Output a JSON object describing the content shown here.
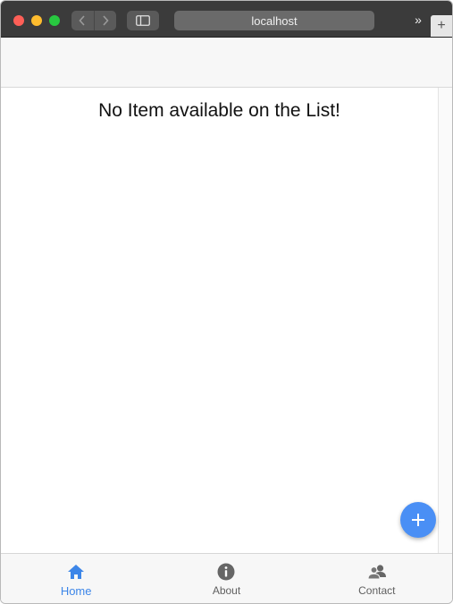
{
  "browser": {
    "url": "localhost",
    "overflow_glyph": "»",
    "new_tab_glyph": "+"
  },
  "main": {
    "empty_message": "No Item available on the List!"
  },
  "fab": {
    "label": "+"
  },
  "tabs": [
    {
      "label": "Home",
      "icon": "home-icon",
      "active": true
    },
    {
      "label": "About",
      "icon": "info-icon",
      "active": false
    },
    {
      "label": "Contact",
      "icon": "contacts-icon",
      "active": false
    }
  ],
  "colors": {
    "accent": "#3d86e8",
    "fab": "#4a8ff5",
    "inactive_tab": "#5f5f5f"
  }
}
